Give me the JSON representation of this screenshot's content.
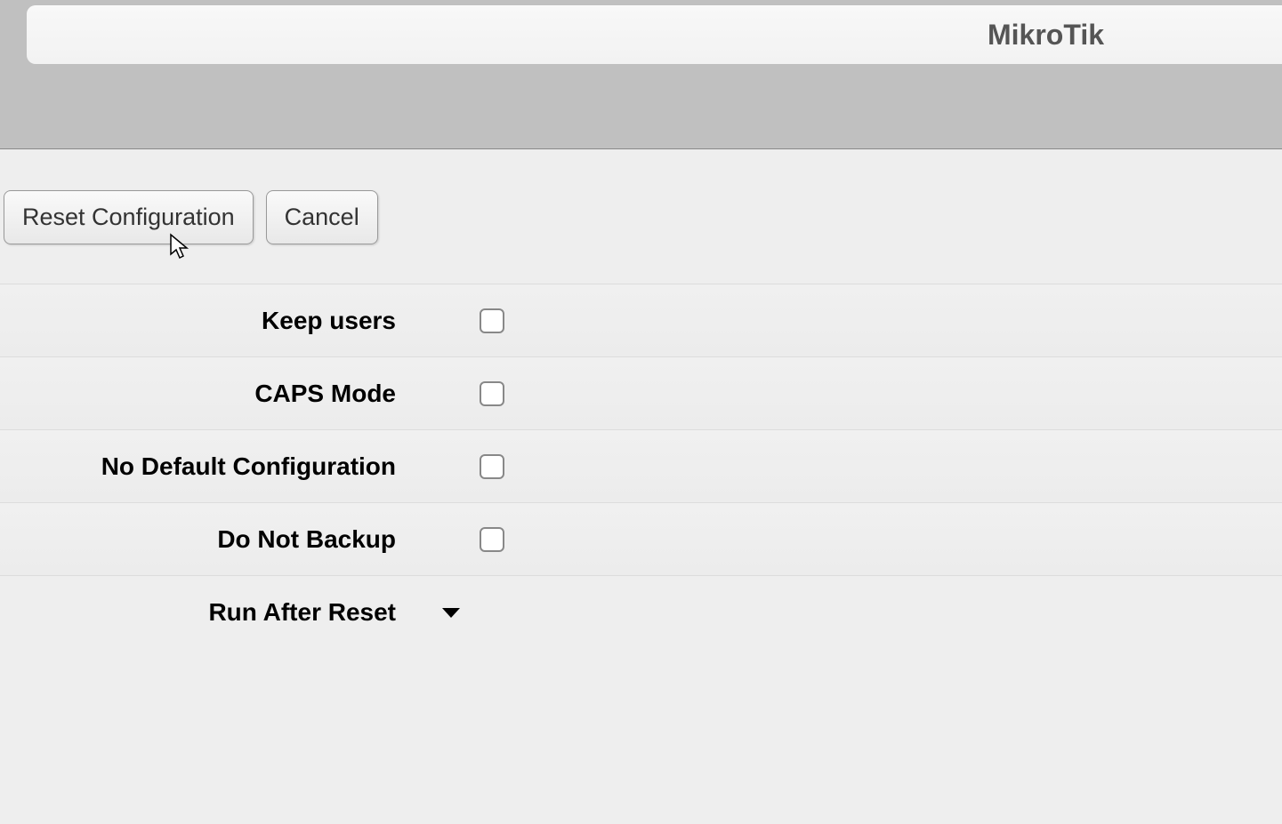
{
  "header": {
    "title": "MikroTik"
  },
  "toolbar": {
    "reset_label": "Reset Configuration",
    "cancel_label": "Cancel"
  },
  "form": {
    "keep_users": {
      "label": "Keep users",
      "checked": false
    },
    "caps_mode": {
      "label": "CAPS Mode",
      "checked": false
    },
    "no_default_config": {
      "label": "No Default Configuration",
      "checked": false
    },
    "do_not_backup": {
      "label": "Do Not Backup",
      "checked": false
    },
    "run_after_reset": {
      "label": "Run After Reset",
      "value": ""
    }
  }
}
